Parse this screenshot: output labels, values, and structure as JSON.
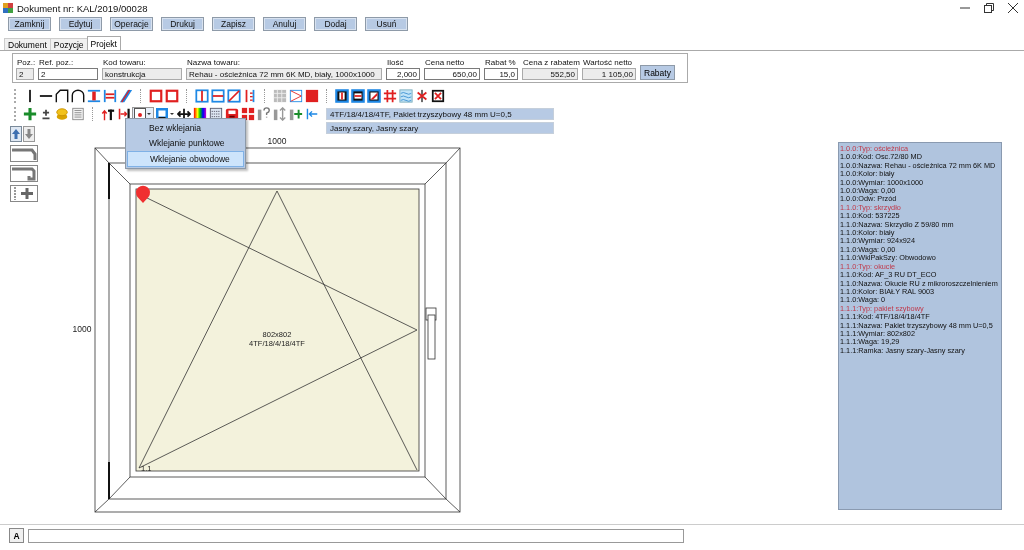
{
  "window": {
    "title": "Dokument nr: KAL/2019/00028"
  },
  "buttons": [
    "Zamknij",
    "Edytuj",
    "Operacje",
    "Drukuj",
    "Zapisz",
    "Anuluj",
    "Dodaj",
    "Usuń"
  ],
  "tabs": [
    {
      "label": "Dokument",
      "selected": false
    },
    {
      "label": "Pozycje",
      "selected": false
    },
    {
      "label": "Projekt",
      "selected": true
    }
  ],
  "item_fields": [
    {
      "label": "Poz.:",
      "value": "2",
      "disabled": true,
      "kind": "text"
    },
    {
      "label": "Ref. poz.:",
      "value": "2",
      "disabled": false,
      "kind": "text"
    },
    {
      "label": "Kod towaru:",
      "value": "konstrukcja",
      "disabled": true,
      "kind": "text"
    },
    {
      "label": "Nazwa towaru:",
      "value": "Rehau - ościeżnica 72 mm 6K MD, biały, 1000x1000",
      "disabled": true,
      "kind": "text"
    },
    {
      "label": "Ilość",
      "value": "2,000",
      "disabled": false,
      "kind": "number"
    },
    {
      "label": "Cena netto",
      "value": "650,00",
      "disabled": false,
      "kind": "number"
    },
    {
      "label": "Rabat %",
      "value": "15,0",
      "disabled": false,
      "kind": "number"
    },
    {
      "label": "Cena z rabatem",
      "value": "552,50",
      "disabled": true,
      "kind": "number"
    },
    {
      "label": "Wartość netto",
      "value": "1 105,00",
      "disabled": true,
      "kind": "number"
    }
  ],
  "rabaty_button": "Rabaty",
  "glass_info": [
    "4TF/18/4/18/4TF, Pakiet trzyszybowy 48 mm U=0,5",
    "Jasny szary, Jasny szary"
  ],
  "dropdown_menu": [
    {
      "label": "Bez wklejania",
      "selected": false
    },
    {
      "label": "Wklejanie punktowe",
      "selected": false
    },
    {
      "label": "Wklejanie obwodowe",
      "selected": true
    }
  ],
  "drawing": {
    "width_label": "1000",
    "height_label": "1000",
    "glass_size": "802x802",
    "glass_code": "4TF/18/4/18/4TF",
    "sash_label": "1.1"
  },
  "properties": [
    {
      "text": "1.0.0:Typ: ościeżnica",
      "kind": "type"
    },
    {
      "text": "1.0.0:Kod: Osc.72/80 MD",
      "kind": "property"
    },
    {
      "text": "1.0.0:Nazwa: Rehau - ościeżnica 72 mm 6K MD",
      "kind": "property"
    },
    {
      "text": "1.0.0:Kolor: biały",
      "kind": "property"
    },
    {
      "text": "1.0.0:Wymiar: 1000x1000",
      "kind": "property"
    },
    {
      "text": "1.0.0:Waga: 0,00",
      "kind": "property"
    },
    {
      "text": "1.0.0:Odw: Przód",
      "kind": "property"
    },
    {
      "text": "1.1.0:Typ: skrzydło",
      "kind": "type"
    },
    {
      "text": "1.1.0:Kod: 537225",
      "kind": "property"
    },
    {
      "text": "1.1.0:Nazwa: Skrzydło Z 59/80 mm",
      "kind": "property"
    },
    {
      "text": "1.1.0:Kolor: biały",
      "kind": "property"
    },
    {
      "text": "1.1.0:Wymiar: 924x924",
      "kind": "property"
    },
    {
      "text": "1.1.0:Waga: 0,00",
      "kind": "property"
    },
    {
      "text": "1.1.0:WklPakSzy: Obwodowo",
      "kind": "property"
    },
    {
      "text": "1.1.0:Typ: okucie",
      "kind": "type"
    },
    {
      "text": "1.1.0:Kod: AF_3 RU DT_ECO",
      "kind": "property"
    },
    {
      "text": "1.1.0:Nazwa: Okucie RU z mikroroszczelnieniem",
      "kind": "property"
    },
    {
      "text": "1.1.0:Kolor: BIAŁY RAL 9003",
      "kind": "property"
    },
    {
      "text": "1.1.0:Waga: 0",
      "kind": "property"
    },
    {
      "text": "1.1.1:Typ: pakiet szybowy",
      "kind": "type"
    },
    {
      "text": "1.1.1:Kod: 4TF/18/4/18/4TF",
      "kind": "property"
    },
    {
      "text": "1.1.1:Nazwa: Pakiet trzyszybowy 48 mm U=0,5",
      "kind": "property"
    },
    {
      "text": "1.1.1:Wymiar: 802x802",
      "kind": "property"
    },
    {
      "text": "1.1.1:Waga: 19,29",
      "kind": "property"
    },
    {
      "text": "1.1.1:Ramka: Jasny szary-Jasny szary",
      "kind": "property"
    }
  ],
  "status_bar": {
    "button": "A"
  }
}
